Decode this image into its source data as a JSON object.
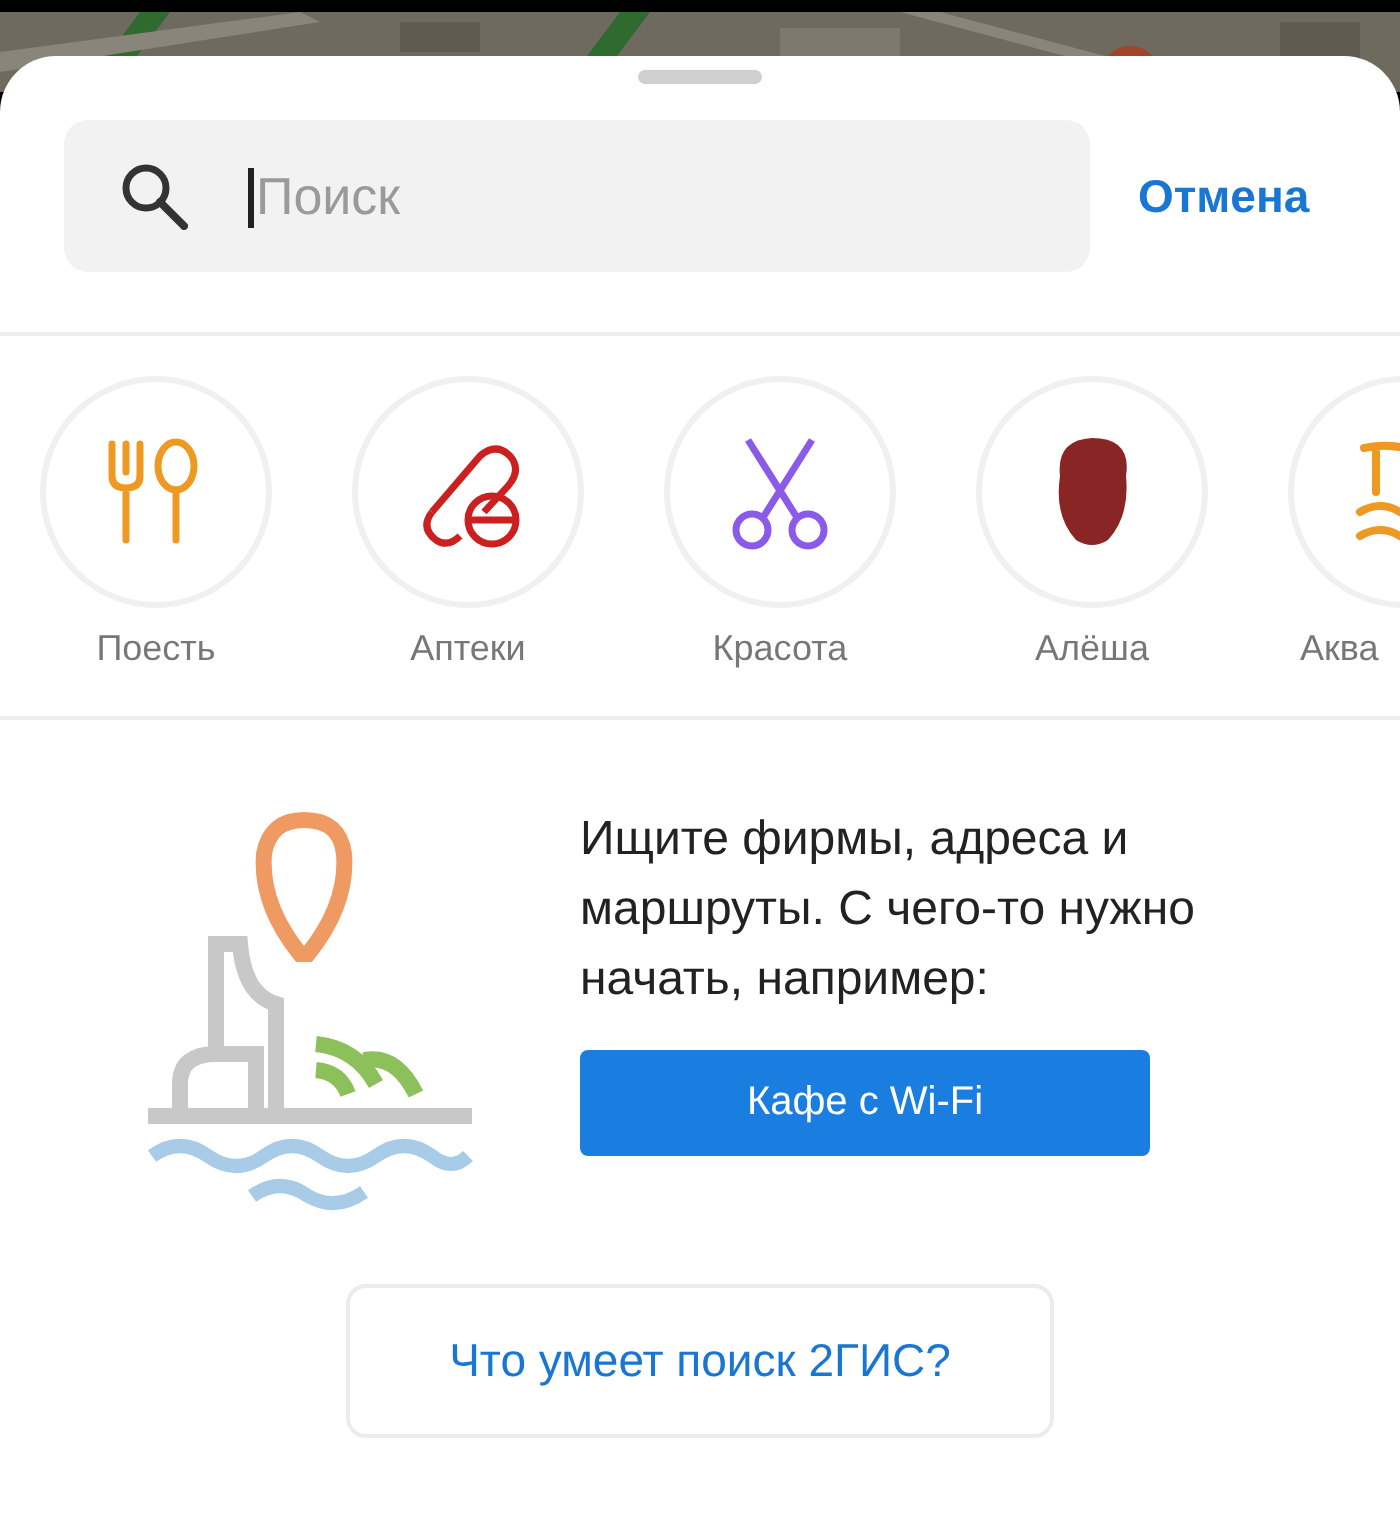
{
  "search": {
    "placeholder": "Поиск",
    "cancel": "Отмена"
  },
  "categories": [
    {
      "label": "Поесть",
      "kind": "food"
    },
    {
      "label": "Аптеки",
      "kind": "pills"
    },
    {
      "label": "Красота",
      "kind": "scissors"
    },
    {
      "label": "Алёша",
      "kind": "person"
    },
    {
      "label": "Аква",
      "kind": "pool"
    }
  ],
  "promo": {
    "text": "Ищите фирмы, адреса и маршруты. С чего-то нужно начать, например:",
    "button": "Кафе с Wi-Fi"
  },
  "help_button": "Что умеет поиск 2ГИС?"
}
